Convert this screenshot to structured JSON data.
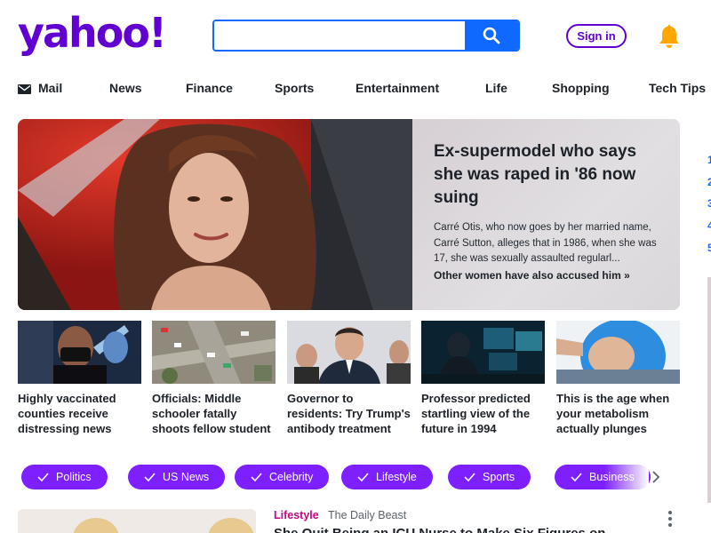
{
  "header": {
    "logo_text": "yahoo!",
    "search": {
      "value": "",
      "placeholder": ""
    },
    "signin_label": "Sign in"
  },
  "nav": {
    "items": [
      {
        "label": "Mail",
        "icon": "mail-icon"
      },
      {
        "label": "News"
      },
      {
        "label": "Finance"
      },
      {
        "label": "Sports"
      },
      {
        "label": "Entertainment"
      },
      {
        "label": "Life"
      },
      {
        "label": "Shopping"
      },
      {
        "label": "Tech Tips"
      }
    ]
  },
  "hero": {
    "title": "Ex-supermodel who says she was raped in '86 now suing",
    "description": "Carré Otis, who now goes by her married name, Carré Sutton, alleges that in 1986, when she was 17, she was sexually assaulted regularl...",
    "more_link": "Other women have also accused him »"
  },
  "stories": [
    {
      "title": "Highly vaccinated counties receive distressing news"
    },
    {
      "title": "Officials: Middle schooler fatally shoots fellow student"
    },
    {
      "title": "Governor to residents: Try Trump's antibody treatment"
    },
    {
      "title": "Professor predicted startling view of the future in 1994"
    },
    {
      "title": "This is the age when your metabolism actually plunges"
    }
  ],
  "topics": [
    {
      "label": "Politics"
    },
    {
      "label": "US News"
    },
    {
      "label": "Celebrity"
    },
    {
      "label": "Lifestyle"
    },
    {
      "label": "Sports"
    },
    {
      "label": "Business"
    }
  ],
  "feed": {
    "category": "Lifestyle",
    "source": "The Daily Beast",
    "title": "She Quit Being an ICU Nurse to Make Six Figures on"
  },
  "trending": {
    "numbers": [
      "1",
      "2",
      "3",
      "4",
      "5"
    ]
  },
  "colors": {
    "brand": "#6001d2",
    "search_blue": "#0f69ff",
    "pill_purple": "#7e1fff",
    "lifestyle_pink": "#c7037f",
    "bell_yellow": "#ffa700"
  }
}
